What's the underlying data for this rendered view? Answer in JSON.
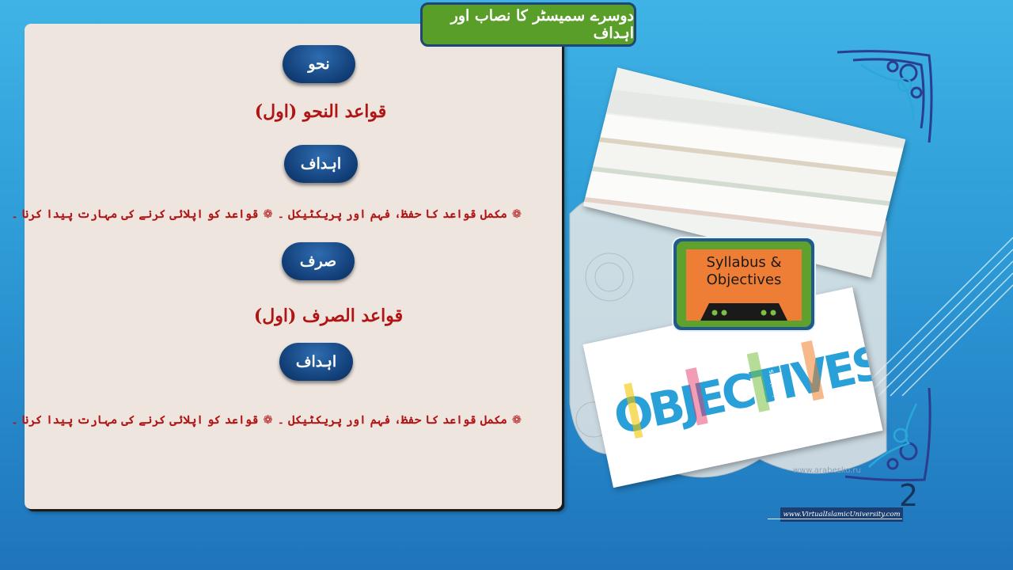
{
  "slide": {
    "title": "دوسرے سمیسٹر کا نصاب اور اہداف",
    "page_number": "2",
    "footer_url": "www.VirtualIslamicUniversity.com",
    "watermark": "www.arabesko.ru"
  },
  "nahw": {
    "badge": "نحو",
    "course": "قواعد النحو (اول)",
    "objectives_badge": "اہداف",
    "objective_1": "مکمل قواعد کا حفظ، فہم اور پریکٹیکل ۔",
    "objective_2": "قواعد کو اپلائی کرنے کی مہارت پیدا کرنا ۔"
  },
  "sarf": {
    "badge": "صرف",
    "course": "قواعد الصرف (اول)",
    "objectives_badge": "اہداف",
    "objective_1": "مکمل قواعد کا حفظ، فہم اور پریکٹیکل ۔",
    "objective_2": "قواعد کو اپلائی کرنے کی مہارت پیدا کرنا ۔"
  },
  "images": {
    "syllabus_card_text": "Syllabus & Objectives",
    "objectives_word": "OBJECTIVES",
    "objectives_small": "Objectives"
  },
  "icons": {
    "bullet": "flower-icon",
    "corner": "arabesque-corner-icon"
  },
  "colors": {
    "background": "#2d9ad6",
    "panel": "#ede5de",
    "title_box": "#5a9e2a",
    "pill": "#123f78",
    "heading_text": "#b01414"
  }
}
